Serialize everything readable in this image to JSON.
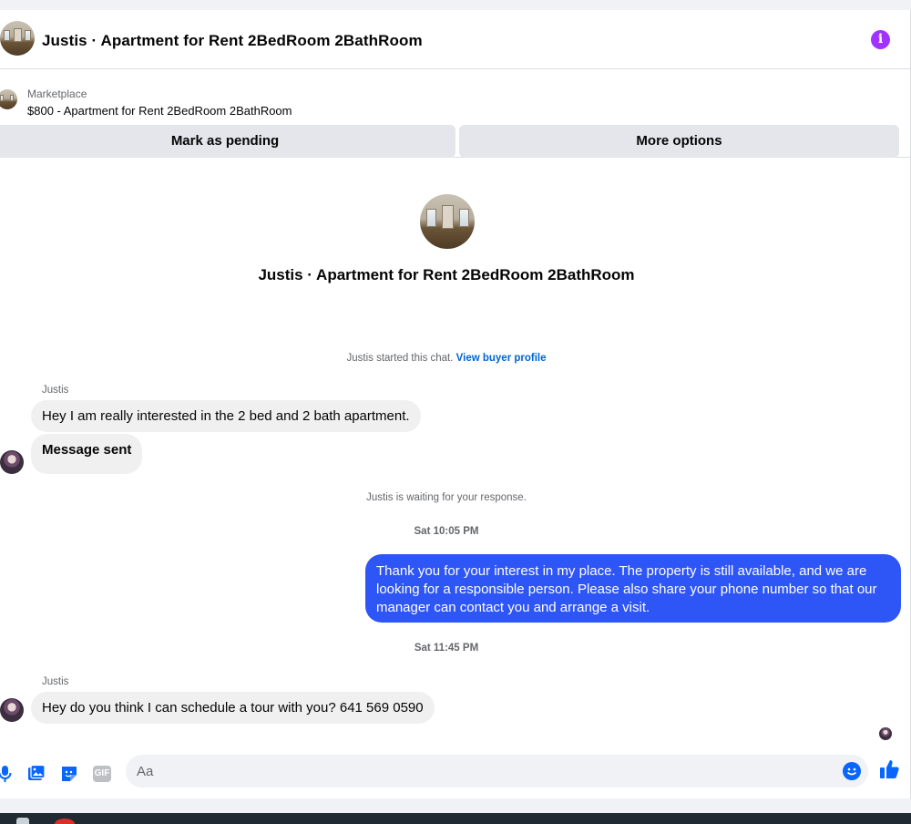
{
  "header": {
    "title": "Justis · Apartment for Rent 2BedRoom 2BathRoom"
  },
  "listing": {
    "category": "Marketplace",
    "price_title": "$800 - Apartment for Rent 2BedRoom 2BathRoom",
    "mark_pending_label": "Mark as pending",
    "more_options_label": "More options"
  },
  "chat": {
    "name": "Justis · Apartment for Rent 2BedRoom 2BathRoom",
    "started_text": "Justis started this chat.",
    "buyer_profile_link": "View buyer profile",
    "waiting_text": "Justis is waiting for your response.",
    "messages": [
      {
        "sender": "Justis",
        "text": "Hey I am really interested in the 2 bed and 2 bath apartment."
      },
      {
        "text": "Message sent"
      },
      {
        "time": "Sat 10:05 PM"
      },
      {
        "text": "Thank you for your interest in my place. The property is still available, and we are looking for a responsible person. Please also share your phone number so that our manager can contact you and arrange a visit."
      },
      {
        "time": "Sat 11:45 PM"
      },
      {
        "sender": "Justis",
        "text": "Hey do you think I can schedule a tour with you? 641 569 0590"
      }
    ]
  },
  "composer": {
    "placeholder": "Aa",
    "gif_label": "GIF",
    "icons": [
      "microphone-icon",
      "photo-icon",
      "sticker-icon",
      "gif-icon",
      "emoji-icon",
      "thumbs-up-icon"
    ]
  },
  "colors": {
    "accent": "#0866ff",
    "outgoing_bubble": "#2e55f6",
    "info": "#a033ff"
  }
}
